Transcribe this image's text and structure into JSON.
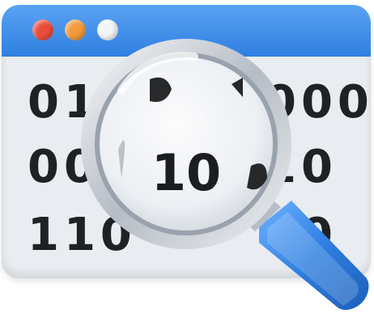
{
  "window": {
    "controls": [
      {
        "name": "close-dot",
        "color": "#ec4d3a"
      },
      {
        "name": "minimize-dot",
        "color": "#f39a3b"
      },
      {
        "name": "maximize-dot",
        "color": "#f3f5f8"
      }
    ]
  },
  "binary_rows": [
    {
      "left": "011",
      "right": "000"
    },
    {
      "left": "00",
      "right": "10"
    },
    {
      "left": "110",
      "right": "00"
    }
  ],
  "magnifier": {
    "lens_text": "10",
    "handle_color": "#2f7fe1"
  },
  "icons": [
    "magnifying-glass-icon"
  ]
}
